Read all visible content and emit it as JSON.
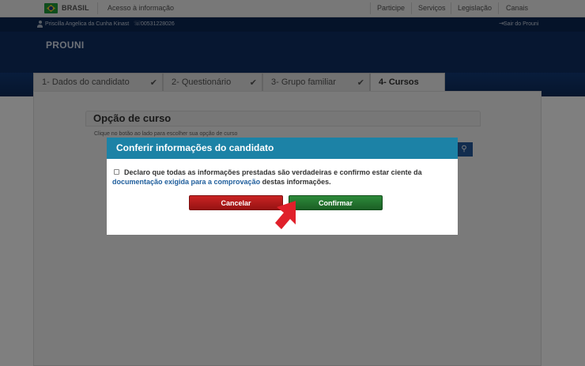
{
  "gov_bar": {
    "country": "BRASIL",
    "access_info": "Acesso à informação",
    "links": [
      "Participe",
      "Serviços",
      "Legislação",
      "Canais"
    ]
  },
  "user_bar": {
    "user_name": "Priscilla Angelica da Cunha Kinast",
    "cpf": "00531228026",
    "logout_label": "Sair do Prouni"
  },
  "brand": "PROUNI",
  "tabs": [
    {
      "label": "1- Dados do candidato",
      "icon": "check-icon",
      "completed": true
    },
    {
      "label": "2- Questionário",
      "icon": "check-icon",
      "completed": true
    },
    {
      "label": "3- Grupo familiar",
      "icon": "check-icon",
      "completed": true
    },
    {
      "label": "4- Cursos",
      "active": true
    }
  ],
  "section": {
    "title": "Opção de curso",
    "hint": "Clique no botão ao lado para escolher sua opção de curso",
    "search_icon": "search-icon"
  },
  "modal": {
    "title": "Conferir informações do candidato",
    "declaration_part1": "Declaro que todas as informações prestadas são verdadeiras e confirmo estar ciente da",
    "declaration_link": "documentação exigida para a comprovação",
    "declaration_part2": "destas informações.",
    "cancel_label": "Cancelar",
    "confirm_label": "Confirmar"
  },
  "colors": {
    "header": "#0e2f63",
    "modal_header": "#1c82a6",
    "cancel": "#b31c1c",
    "confirm": "#237a30",
    "arrow": "#e0202a"
  }
}
